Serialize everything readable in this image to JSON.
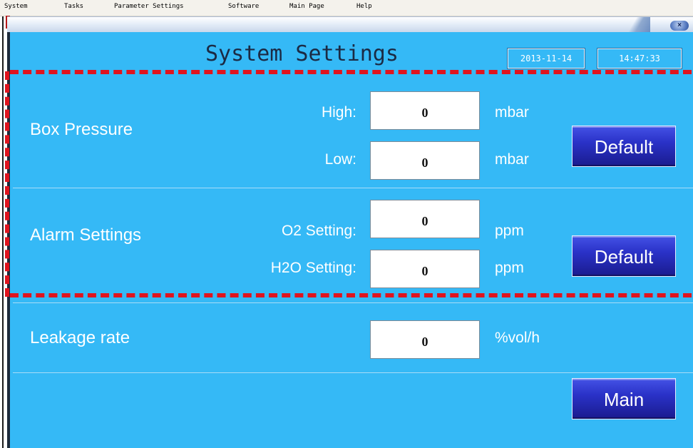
{
  "menu": [
    "System",
    "Tasks",
    "Parameter Settings",
    "Software",
    "Main Page",
    "Help"
  ],
  "window": {
    "close_glyph": "×"
  },
  "header": {
    "title": "System Settings",
    "date": "2013-11-14",
    "time": "14:47:33"
  },
  "box_pressure": {
    "label": "Box Pressure",
    "high_label": "High:",
    "high_value": "0",
    "high_unit": "mbar",
    "low_label": "Low:",
    "low_value": "0",
    "low_unit": "mbar",
    "button": "Default"
  },
  "alarm": {
    "label": "Alarm Settings",
    "o2_label": "O2 Setting:",
    "o2_value": "0",
    "o2_unit": "ppm",
    "h2o_label": "H2O Setting:",
    "h2o_value": "0",
    "h2o_unit": "ppm",
    "button": "Default"
  },
  "leakage": {
    "label": "Leakage rate",
    "value": "0",
    "unit": "%vol/h"
  },
  "footer": {
    "main_button": "Main"
  },
  "colors": {
    "panel": "#35b9f6",
    "highlight": "#e0141e",
    "button": "#2a32c8"
  }
}
